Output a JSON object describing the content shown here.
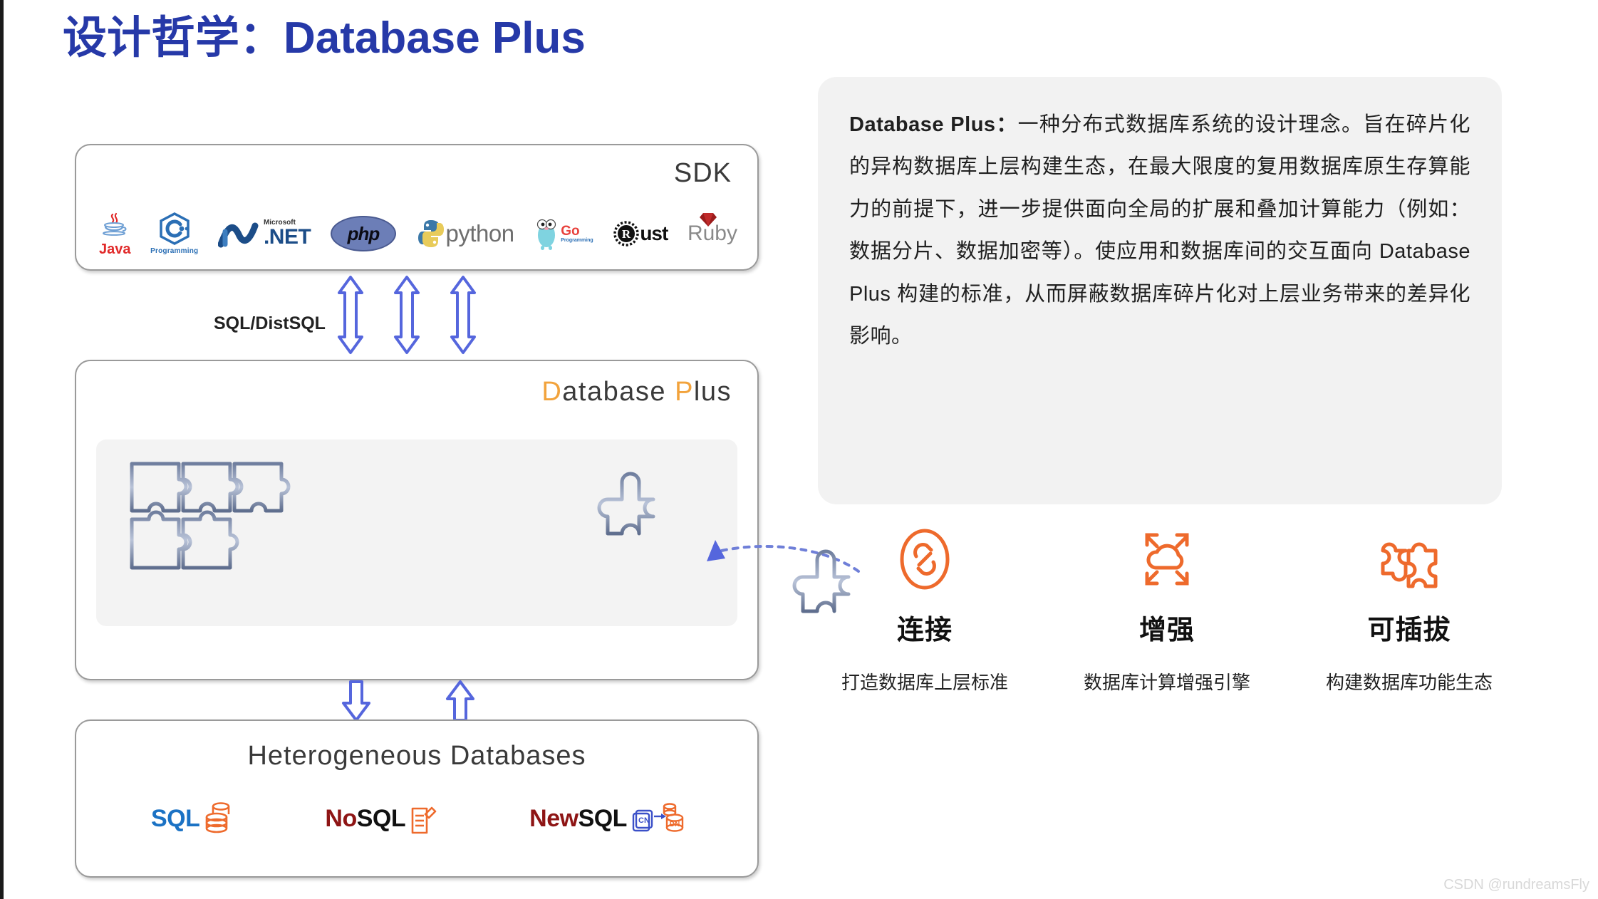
{
  "title": "设计哲学：Database Plus",
  "accent_color": "#2639a8",
  "brand_orange": "#ee6a2c",
  "layers": {
    "sdk": {
      "label": "SDK",
      "logos": [
        {
          "name": "java-logo",
          "text": "Java",
          "sub": ""
        },
        {
          "name": "c-programming-logo",
          "text": "C",
          "sub": "Programming"
        },
        {
          "name": "dotnet-logo",
          "text": ".NET",
          "sub": "Microsoft"
        },
        {
          "name": "php-logo",
          "text": "php",
          "sub": ""
        },
        {
          "name": "python-logo",
          "text": "python",
          "sub": ""
        },
        {
          "name": "go-logo",
          "text": "Go",
          "sub": "Programming"
        },
        {
          "name": "rust-logo",
          "text": "ust",
          "sub": "R"
        },
        {
          "name": "ruby-logo",
          "text": "Ruby",
          "sub": ""
        }
      ]
    },
    "connector_top": {
      "label": "SQL/DistSQL",
      "arrow_count": 3,
      "arrow_type": "double-headed-vertical",
      "arrow_color": "#5566dd"
    },
    "database_plus": {
      "wordmark_lead": "D",
      "wordmark_rest": "atabase ",
      "wordmark_lead2": "P",
      "wordmark_rest2": "lus"
    },
    "connector_bottom": {
      "down_arrow": "down",
      "up_arrow": "up",
      "arrow_color": "#5566dd"
    },
    "heterogeneous": {
      "label": "Heterogeneous Databases",
      "databases": [
        {
          "name": "sql-logo",
          "text": "SQL"
        },
        {
          "name": "nosql-logo",
          "prefix": "No",
          "text": "SQL"
        },
        {
          "name": "newsql-logo",
          "prefix": "New",
          "text": "SQL",
          "badge_left": "CN",
          "badge_right": "DN"
        }
      ]
    }
  },
  "description": {
    "lead": "Database  Plus：",
    "body": "一种分布式数据库系统的设计理念。旨在碎片化的异构数据库上层构建生态，在最大限度的复用数据库原生存算能力的前提下，进一步提供面向全局的扩展和叠加计算能力（例如：数据分片、数据加密等）。使应用和数据库间的交互面向 Database Plus 构建的标准，从而屏蔽数据库碎片化对上层业务带来的差异化影响。"
  },
  "features": [
    {
      "icon": "link-icon",
      "title": "连接",
      "caption": "打造数据库上层标准"
    },
    {
      "icon": "cloud-expand-icon",
      "title": "增强",
      "caption": "数据库计算增强引擎"
    },
    {
      "icon": "puzzle-pieces-icon",
      "title": "可插拔",
      "caption": "构建数据库功能生态"
    }
  ],
  "watermark": "CSDN @rundreamsFly"
}
